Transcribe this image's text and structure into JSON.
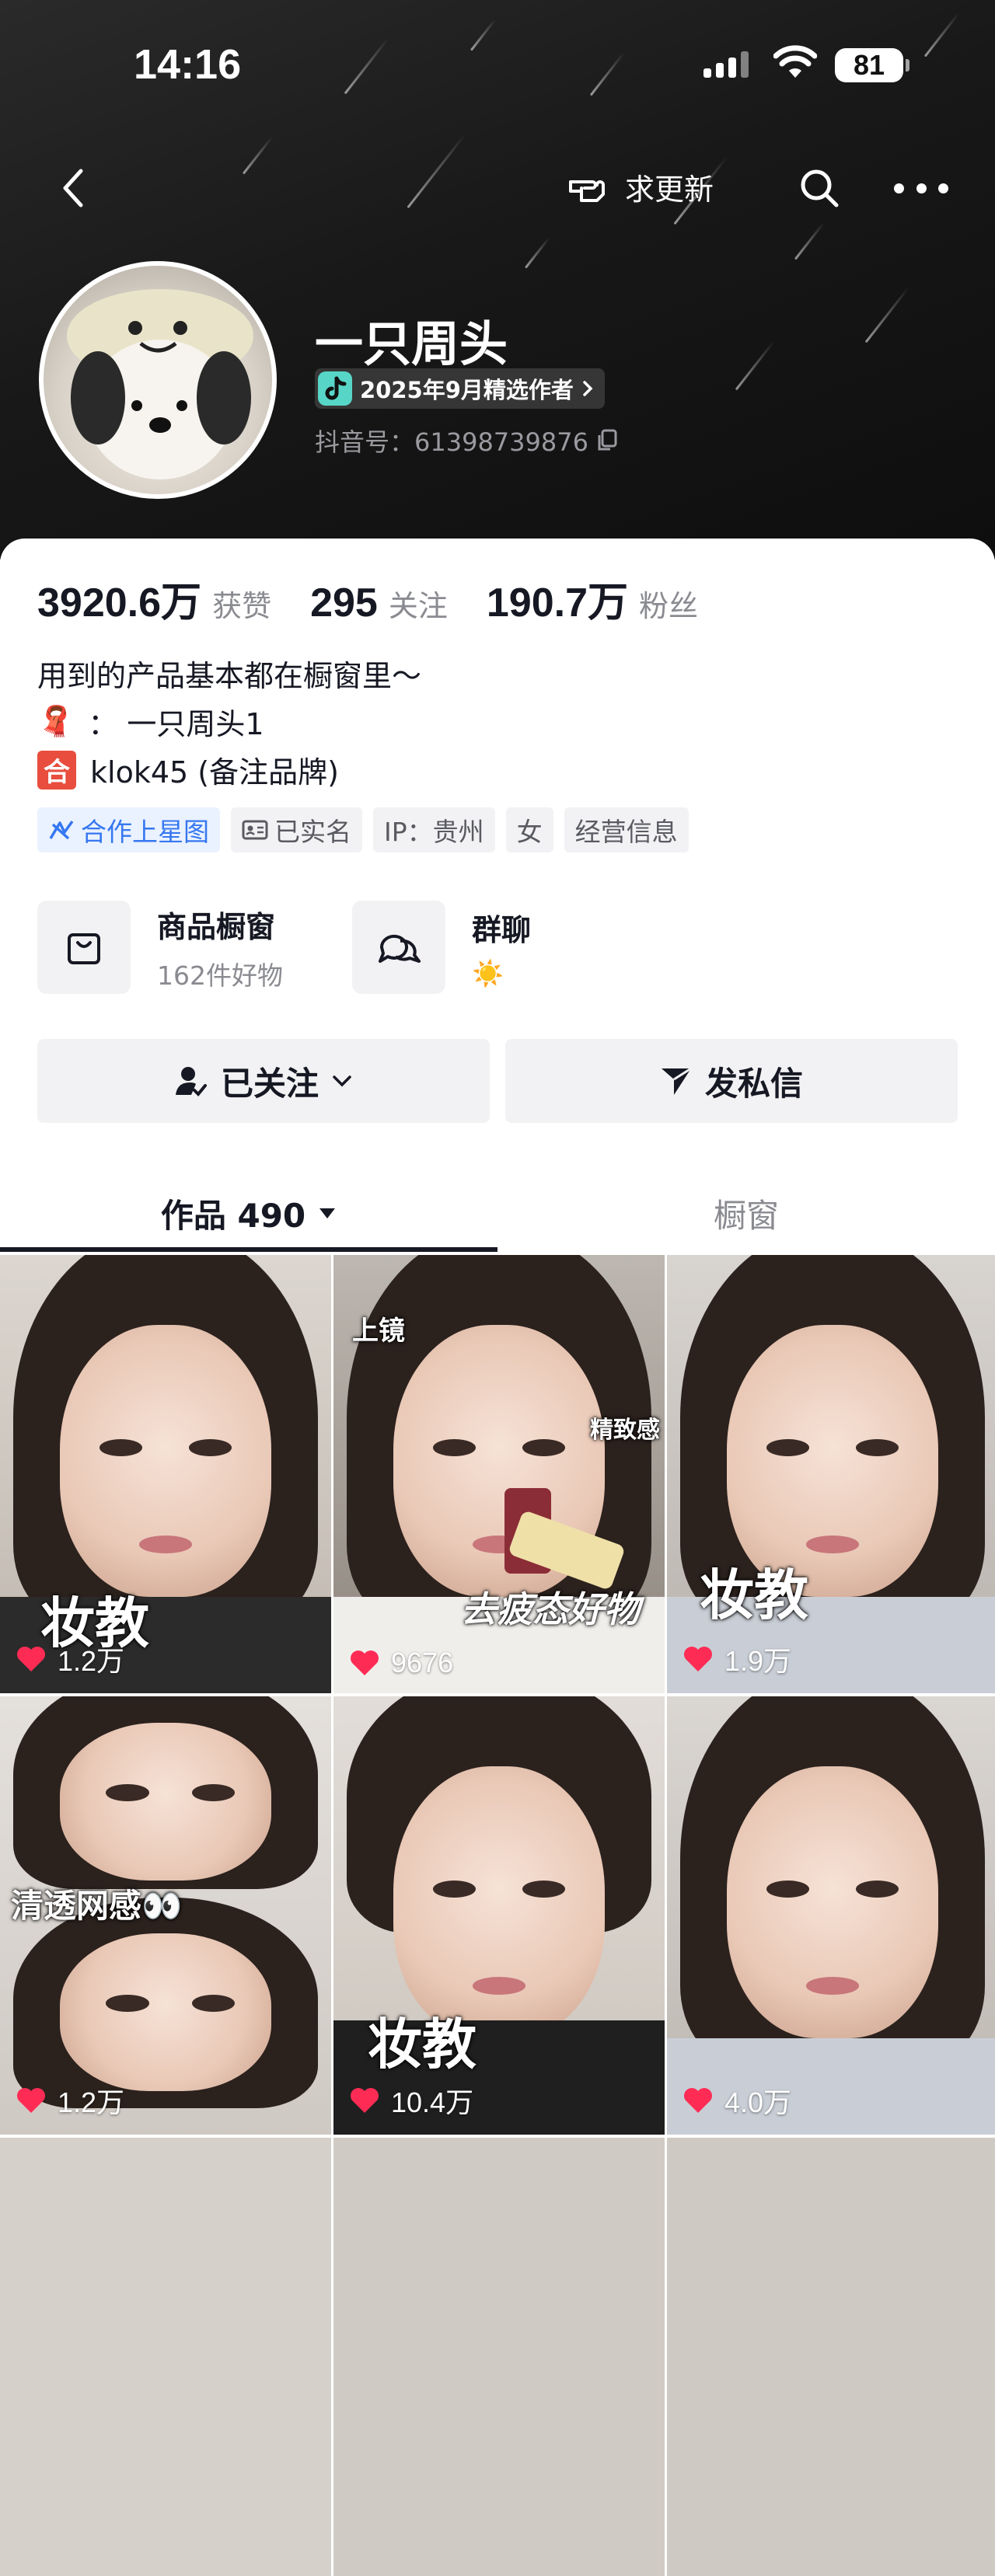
{
  "status_bar": {
    "time": "14:16",
    "battery": "81"
  },
  "top_bar": {
    "request_update_label": "求更新"
  },
  "profile": {
    "nickname": "一只周头",
    "badge": "2025年9月精选作者",
    "douyin_id": "抖音号：61398739876"
  },
  "stats": [
    {
      "value": "3920.6万",
      "label": "获赞"
    },
    {
      "value": "295",
      "label": "关注"
    },
    {
      "value": "190.7万",
      "label": "粉丝"
    }
  ],
  "bio": {
    "line1": "用到的产品基本都在橱窗里～",
    "line2_icon": "🧣",
    "line2": "：  一只周头1",
    "line3_icon": "合",
    "line3": "klok45 (备注品牌)"
  },
  "tags": [
    "合作上星图",
    "已实名",
    "IP：贵州",
    "女",
    "经营信息"
  ],
  "services": {
    "shop": {
      "title": "商品橱窗",
      "subtitle": "162件好物"
    },
    "group": {
      "title": "群聊",
      "subtitle": "☀️"
    }
  },
  "actions": {
    "following": "已关注",
    "message": "发私信"
  },
  "tabs": {
    "works": "作品 490",
    "showcase": "橱窗"
  },
  "videos": [
    {
      "caption": "妆教",
      "likes": "1.2万"
    },
    {
      "caption": "去疲态好物",
      "likes": "9676",
      "extra1": "上镜",
      "extra2": "精致感"
    },
    {
      "caption": "妆教",
      "likes": "1.9万"
    },
    {
      "caption": "清透网感👀",
      "likes": "1.2万"
    },
    {
      "caption": "妆教",
      "likes": "10.4万"
    },
    {
      "caption": "",
      "likes": "4.0万"
    }
  ],
  "colors": {
    "like_heart": "#fe2c55",
    "accent_blue": "#3677f0"
  }
}
